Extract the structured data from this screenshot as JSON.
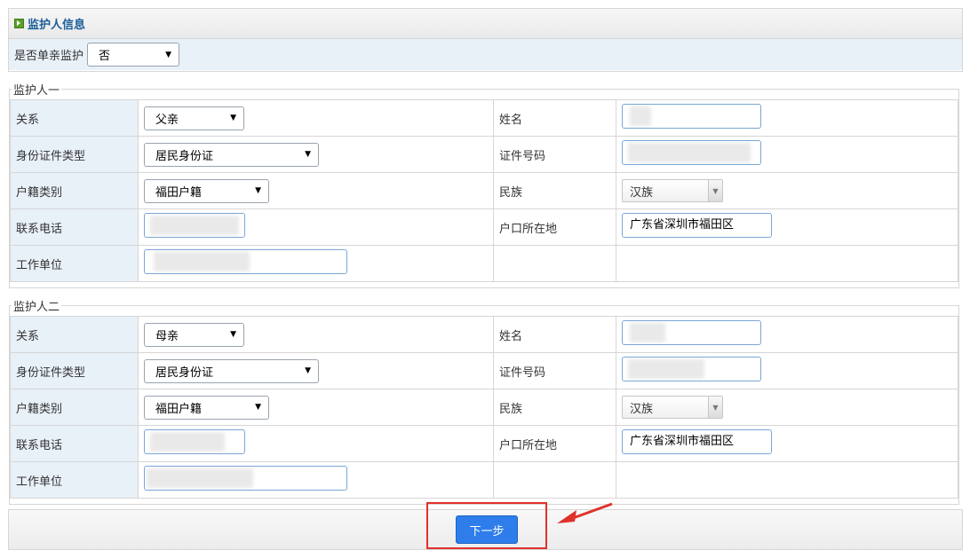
{
  "panel": {
    "title": "监护人信息"
  },
  "single_custody": {
    "label": "是否单亲监护",
    "value": "否"
  },
  "guardians": [
    {
      "legend": "监护人一",
      "relation_label": "关系",
      "relation": "父亲",
      "name_label": "姓名",
      "name": "",
      "id_type_label": "身份证件类型",
      "id_type": "居民身份证",
      "id_number_label": "证件号码",
      "id_number": "",
      "household_type_label": "户籍类别",
      "household_type": "福田户籍",
      "ethnicity_label": "民族",
      "ethnicity": "汉族",
      "phone_label": "联系电话",
      "phone": "",
      "household_location_label": "户口所在地",
      "household_location": "广东省深圳市福田区",
      "workplace_label": "工作单位",
      "workplace": ""
    },
    {
      "legend": "监护人二",
      "relation_label": "关系",
      "relation": "母亲",
      "name_label": "姓名",
      "name": "",
      "id_type_label": "身份证件类型",
      "id_type": "居民身份证",
      "id_number_label": "证件号码",
      "id_number": "",
      "household_type_label": "户籍类别",
      "household_type": "福田户籍",
      "ethnicity_label": "民族",
      "ethnicity": "汉族",
      "phone_label": "联系电话",
      "phone": "",
      "household_location_label": "户口所在地",
      "household_location": "广东省深圳市福田区",
      "workplace_label": "工作单位",
      "workplace": ""
    }
  ],
  "footer": {
    "next_label": "下一步"
  },
  "colors": {
    "accent": "#2e7dea",
    "annotation": "#e0312b",
    "label_bg": "#e8f0f8"
  }
}
